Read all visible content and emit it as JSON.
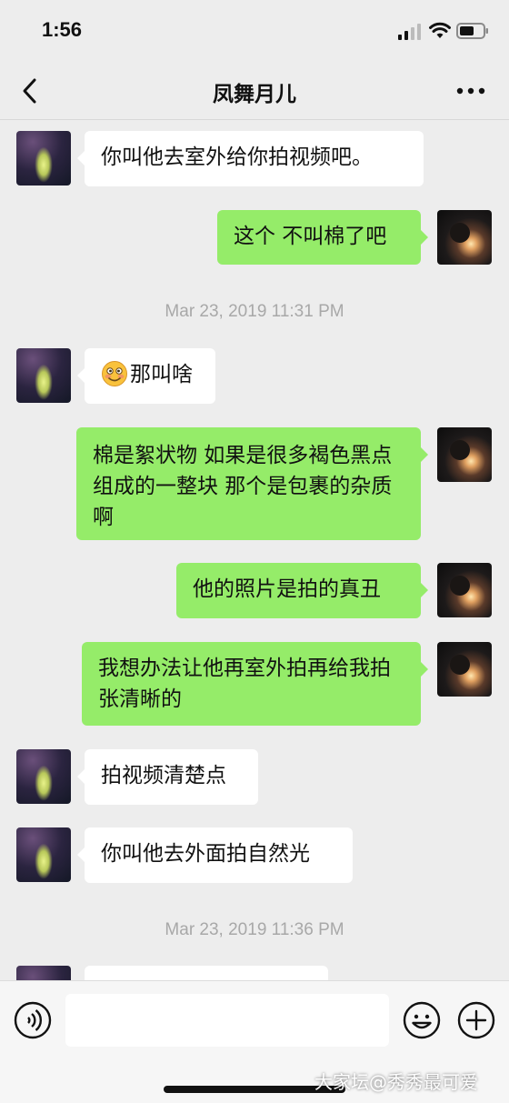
{
  "status_bar": {
    "time": "1:56"
  },
  "nav": {
    "title": "凤舞月儿"
  },
  "messages": [
    {
      "side": "left",
      "text": "你叫他去室外给你拍视频吧。"
    },
    {
      "side": "right",
      "text": "这个 不叫棉了吧"
    },
    {
      "type": "timestamp",
      "text": "Mar 23, 2019 11:31 PM"
    },
    {
      "side": "left",
      "emoji": "embarrassed-smile-icon",
      "text": "那叫啥"
    },
    {
      "side": "right",
      "text": "棉是絮状物 如果是很多褐色黑点组成的一整块 那个是包裹的杂质啊"
    },
    {
      "side": "right",
      "text": "他的照片是拍的真丑"
    },
    {
      "side": "right",
      "text": "我想办法让他再室外拍再给我拍张清晰的"
    },
    {
      "side": "left",
      "text": "拍视频清楚点"
    },
    {
      "side": "left",
      "text": "你叫他去外面拍自然光"
    },
    {
      "type": "timestamp",
      "text": "Mar 23, 2019 11:36 PM"
    }
  ],
  "input": {
    "placeholder": ""
  },
  "watermark": "大家坛@秀秀最可爱",
  "colors": {
    "background": "#ededed",
    "bubble_sent": "#95ec69",
    "bubble_received": "#ffffff"
  }
}
